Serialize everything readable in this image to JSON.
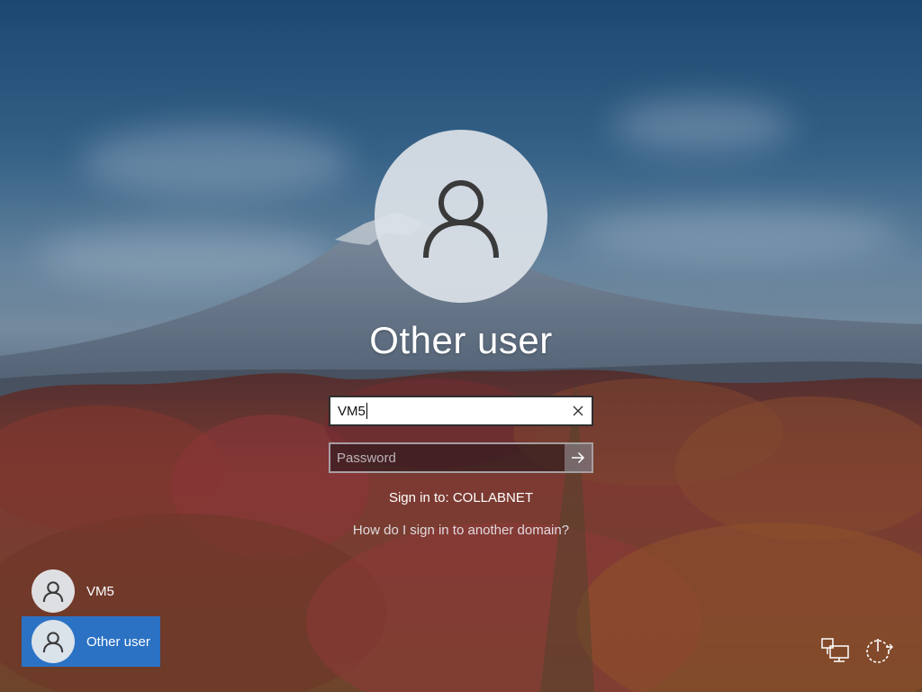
{
  "login": {
    "user_title": "Other user",
    "username_value": "VM5",
    "password_placeholder": "Password",
    "sign_in_to": "Sign in to: COLLABNET",
    "domain_help_link": "How do I sign in to another domain?"
  },
  "user_list": {
    "items": [
      {
        "label": "VM5",
        "selected": false,
        "icon": "user-icon"
      },
      {
        "label": "Other user",
        "selected": true,
        "icon": "user-icon"
      }
    ]
  },
  "system_icons": {
    "network": "network-icon",
    "power": "power-icon"
  },
  "colors": {
    "selected_tile": "#2b72c4",
    "avatar_bg": "#dce2e8",
    "text": "#ffffff"
  }
}
